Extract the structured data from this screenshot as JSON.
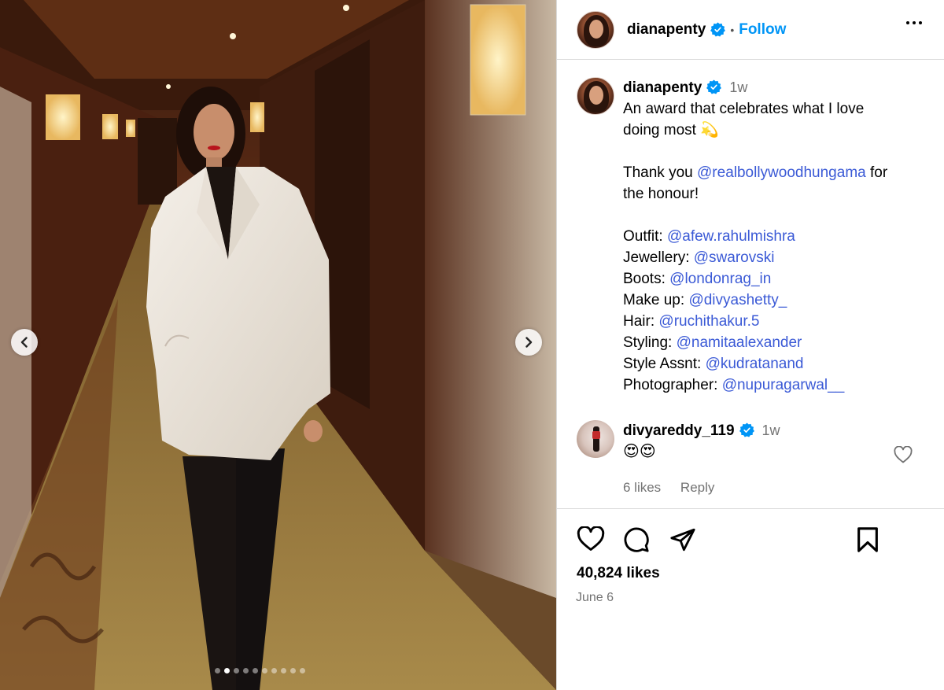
{
  "post": {
    "username": "dianapenty",
    "follow_label": "Follow",
    "separator": "•"
  },
  "caption": {
    "username": "dianapenty",
    "time": "1w",
    "lines": {
      "l1": "An award that celebrates what I love",
      "l2": "doing most",
      "l2_emoji": "💫",
      "thanks_pre": "Thank you",
      "thanks_mention": "@realbollywoodhungama",
      "thanks_post": "for",
      "thanks_l2": "the honour!",
      "credits": [
        {
          "label": "Outfit:",
          "mention": "@afew.rahulmishra"
        },
        {
          "label": "Jewellery:",
          "mention": "@swarovski"
        },
        {
          "label": "Boots:",
          "mention": "@londonrag_in"
        },
        {
          "label": "Make up:",
          "mention": "@divyashetty_"
        },
        {
          "label": "Hair:",
          "mention": "@ruchithakur.5"
        },
        {
          "label": "Styling:",
          "mention": "@namitaalexander"
        },
        {
          "label": "Style Assnt:",
          "mention": "@kudratanand"
        },
        {
          "label": "Photographer:",
          "mention": "@nupuragarwal__"
        }
      ]
    }
  },
  "comment": {
    "username": "divyareddy_119",
    "time": "1w",
    "text": "😍😍",
    "likes": "6 likes",
    "reply": "Reply"
  },
  "footer": {
    "likes": "40,824 likes",
    "date": "June 6"
  },
  "carousel": {
    "total": 10,
    "active_index": 1
  },
  "colors": {
    "link": "#3b5ad6",
    "follow": "#0095f6",
    "verified": "#0095f6",
    "muted": "#737373"
  }
}
